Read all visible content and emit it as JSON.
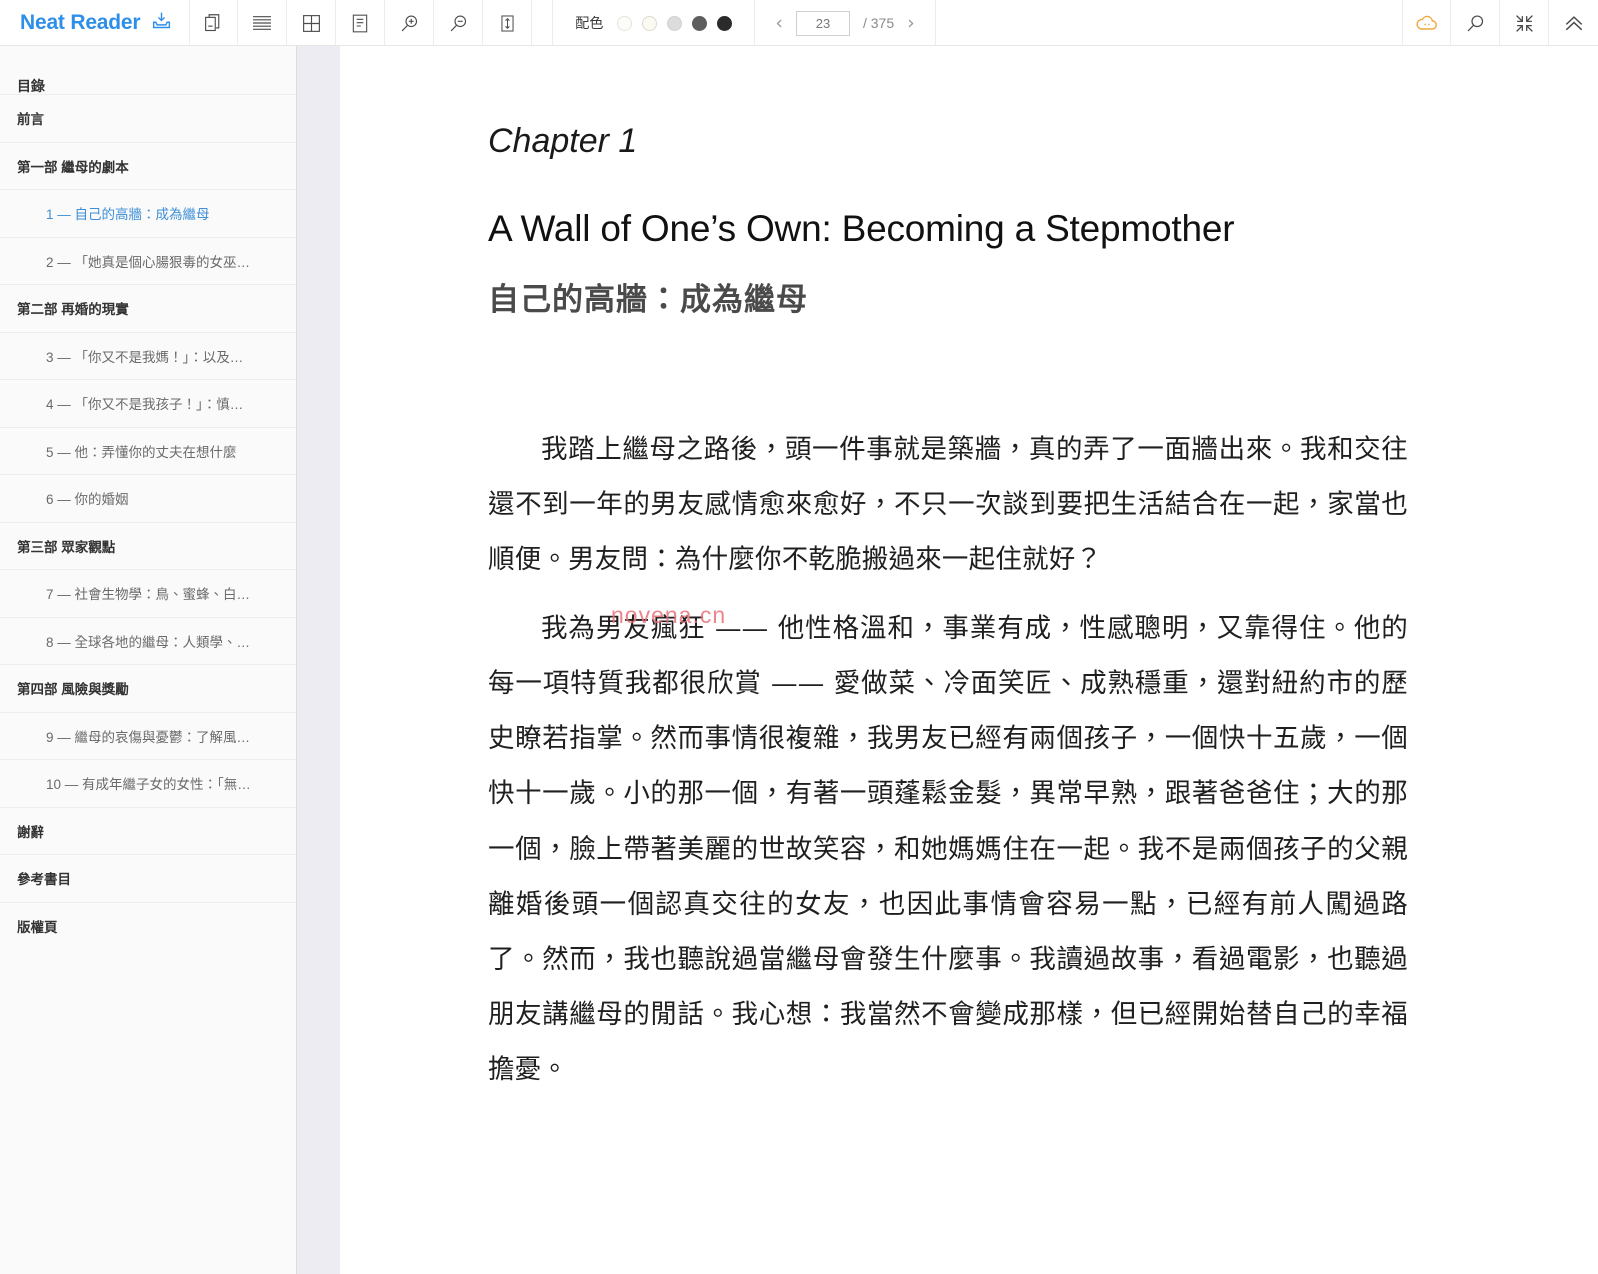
{
  "app": {
    "brand": "Neat Reader",
    "brand_color": "#2e8fe8"
  },
  "toolbar": {
    "icons": [
      {
        "name": "download-icon",
        "title": "下載"
      },
      {
        "name": "copy-pages-icon",
        "title": "複製"
      },
      {
        "name": "lines-icon",
        "title": "行距"
      },
      {
        "name": "grid-layout-icon",
        "title": "版面"
      },
      {
        "name": "note-icon",
        "title": "筆記"
      },
      {
        "name": "zoom-in-icon",
        "title": "放大"
      },
      {
        "name": "zoom-out-icon",
        "title": "縮小"
      },
      {
        "name": "line-height-icon",
        "title": "行高"
      }
    ],
    "scheme": {
      "label": "配色",
      "swatches": [
        "#fdfcf8",
        "#fcfbf3",
        "#dcdcdc",
        "#5e5e5e",
        "#2b2b2b"
      ],
      "selected_index": 0
    },
    "pager": {
      "prev_label": "‹",
      "next_label": "›",
      "current_page": "23",
      "total_label": "/ 375",
      "placeholder": "23"
    },
    "right_icons": [
      {
        "name": "cloud-sync-icon",
        "title": "雲端",
        "color": "#f0a73c"
      },
      {
        "name": "search-icon",
        "title": "搜尋",
        "color": "#4a4a4a"
      },
      {
        "name": "shrink-icon",
        "title": "收合",
        "color": "#4a4a4a"
      },
      {
        "name": "chevron-up-icon",
        "title": "收起工具列",
        "color": "#4a4a4a"
      }
    ]
  },
  "sidebar": {
    "title": "目錄",
    "items": [
      {
        "label": "前言",
        "level": 0,
        "active": false
      },
      {
        "label": "第一部 繼母的劇本",
        "level": 0,
        "active": false
      },
      {
        "label": "1 — 自己的高牆：成為繼母",
        "level": 1,
        "active": true
      },
      {
        "label": "2 — 「她真是個心腸狠毒的女巫…",
        "level": 1,
        "active": false
      },
      {
        "label": "第二部 再婚的現實",
        "level": 0,
        "active": false
      },
      {
        "label": "3 — 「你又不是我媽！」：以及…",
        "level": 1,
        "active": false
      },
      {
        "label": "4 — 「你又不是我孩子！」：慎…",
        "level": 1,
        "active": false
      },
      {
        "label": "5 — 他：弄懂你的丈夫在想什麼",
        "level": 1,
        "active": false
      },
      {
        "label": "6 — 你的婚姻",
        "level": 1,
        "active": false
      },
      {
        "label": "第三部 眾家觀點",
        "level": 0,
        "active": false
      },
      {
        "label": "7 — 社會生物學：鳥、蜜蜂、白…",
        "level": 1,
        "active": false
      },
      {
        "label": "8 — 全球各地的繼母：人類學、…",
        "level": 1,
        "active": false
      },
      {
        "label": "第四部 風險與獎勵",
        "level": 0,
        "active": false
      },
      {
        "label": "9 — 繼母的哀傷與憂鬱：了解風…",
        "level": 1,
        "active": false
      },
      {
        "label": "10 — 有成年繼子女的女性：「無…",
        "level": 1,
        "active": false
      },
      {
        "label": "謝辭",
        "level": 0,
        "active": false
      },
      {
        "label": "參考書目",
        "level": 0,
        "active": false
      },
      {
        "label": "版權頁",
        "level": 0,
        "active": false
      }
    ]
  },
  "reader": {
    "chapter_label": "Chapter 1",
    "title_en": "A Wall of One’s Own: Becoming a Stepmother",
    "title_zh": "自己的高牆：成為繼母",
    "paragraphs": [
      "我踏上繼母之路後，頭一件事就是築牆，真的弄了一面牆出來。我和交往還不到一年的男友感情愈來愈好，不只一次談到要把生活結合在一起，家當也順便。男友問：為什麼你不乾脆搬過來一起住就好？",
      "我為男友瘋狂 —— 他性格溫和，事業有成，性感聰明，又靠得住。他的每一項特質我都很欣賞 —— 愛做菜、冷面笑匠、成熟穩重，還對紐約市的歷史瞭若指掌。然而事情很複雜，我男友已經有兩個孩子，一個快十五歲，一個快十一歲。小的那一個，有著一頭蓬鬆金髮，異常早熟，跟著爸爸住；大的那一個，臉上帶著美麗的世故笑容，和她媽媽住在一起。我不是兩個孩子的父親離婚後頭一個認真交往的女友，也因此事情會容易一點，已經有前人闖過路了。然而，我也聽說過當繼母會發生什麼事。我讀過故事，看過電影，也聽過朋友講繼母的閒話。我心想：我當然不會變成那樣，但已經開始替自己的幸福擔憂。"
    ],
    "watermark": "novena.cn"
  }
}
